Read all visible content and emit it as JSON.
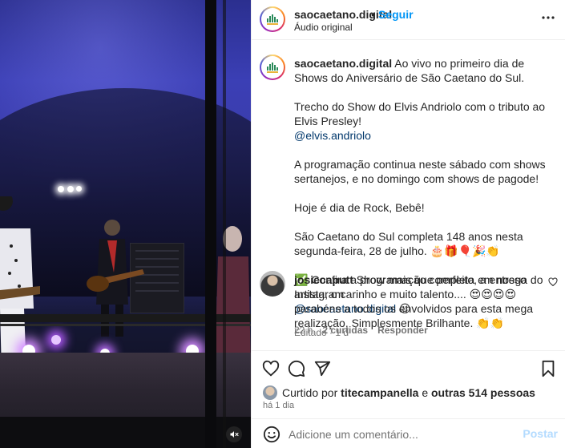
{
  "post": {
    "username": "saocaetano.digital",
    "separator": "•",
    "follow_label": "Seguir",
    "audio_label": "Áudio original"
  },
  "caption": {
    "username": "saocaetano.digital",
    "line1": "Ao vivo no primeiro dia de Shows do Aniversário de São Caetano do Sul.",
    "line2": "Trecho do Show do Elvis Andriolo com o tributo ao Elvis Presley!",
    "mention1": "@elvis.andriolo",
    "line3": "A programação continua neste sábado com shows sertanejos, e no domingo com shows de pagode!",
    "line4": "Hoje é dia de Rock, Bebê!",
    "line5": "São Caetano do Sul completa 148 anos nesta segunda-feira, 28 de julho. 🎂🎁🎈🎉👏",
    "line6": "✅ Confira a programação completa em nosso Instagram",
    "mention2": "@saocaetano.digital",
    "line6_emoji": "😉",
    "meta": "Editado · 1 d"
  },
  "comment": {
    "username": "josiecaputt",
    "text": "Show mais que perfeito, a entrega do artista, o carinho e muito talento.... 😍😍😍😍 parabéns a todos os envolvidos para esta mega realização. Simplesmente Brilhante. 👏👏",
    "time": "22 h",
    "likes": "2 curtidas",
    "reply": "Responder"
  },
  "likes": {
    "prefix": "Curtido por",
    "user": "titecampanella",
    "middle": "e",
    "others": "outras 514 pessoas"
  },
  "time_ago": "há 1 dia",
  "add_comment": {
    "placeholder": "Adicione um comentário...",
    "post_label": "Postar"
  },
  "icons": {
    "more": "more-horizontal-icon",
    "like": "heart-icon",
    "comment": "comment-icon",
    "share": "send-icon",
    "save": "bookmark-icon",
    "mute": "speaker-muted-icon",
    "emoji": "emoji-icon"
  },
  "colors": {
    "link": "#0095f6",
    "mention": "#00376b",
    "muted": "#737373",
    "post_disabled": "#b3dbff"
  }
}
